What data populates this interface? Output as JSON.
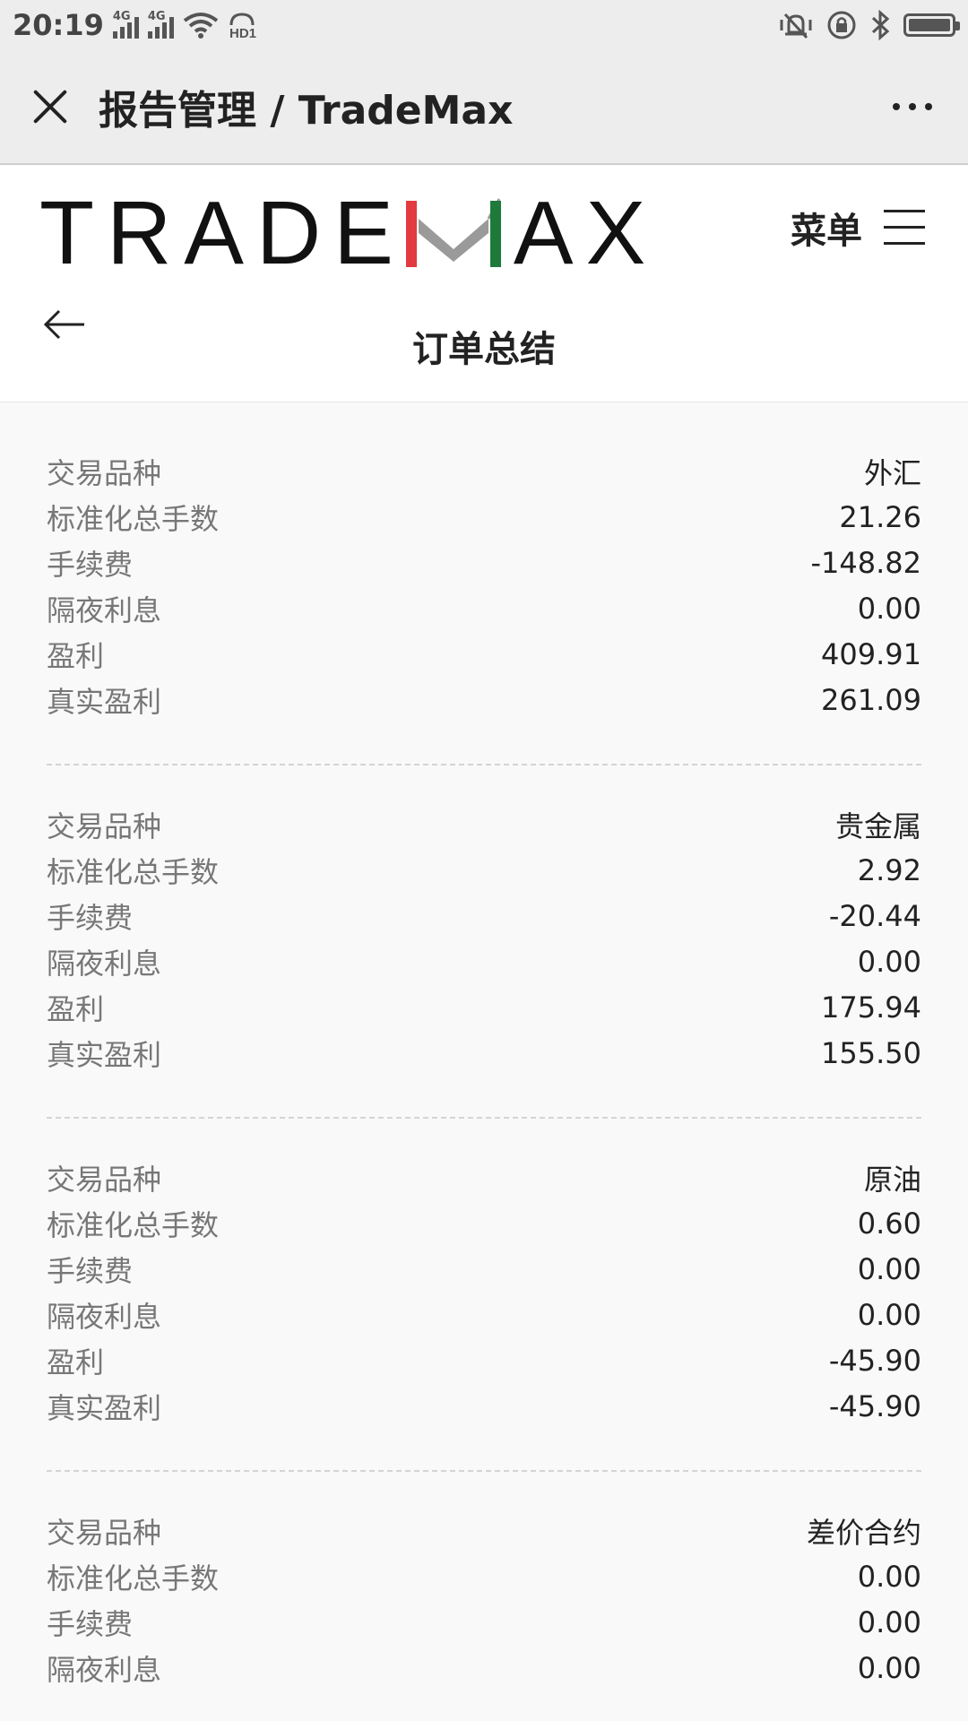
{
  "status_bar": {
    "time": "20:19",
    "network_1": "4G",
    "network_2": "4G",
    "hd_label": "HD1",
    "icons": [
      "signal-icon",
      "wifi-icon",
      "hd-icon",
      "vibrate-icon",
      "rotation-lock-icon",
      "bluetooth-icon",
      "battery-icon"
    ],
    "battery_level": 1.0
  },
  "title_bar": {
    "title": "报告管理 / TradeMax"
  },
  "header": {
    "logo_left": "TRADE",
    "logo_right": "AX",
    "menu_label": "菜单",
    "page_title": "订单总结",
    "colors": {
      "logo_red": "#e23a3f",
      "logo_green": "#1e7a3a",
      "logo_gray": "#9a9a9a"
    }
  },
  "summary": [
    {
      "rows": [
        {
          "label": "交易品种",
          "value": "外汇"
        },
        {
          "label": "标准化总手数",
          "value": "21.26"
        },
        {
          "label": "手续费",
          "value": "-148.82"
        },
        {
          "label": "隔夜利息",
          "value": "0.00"
        },
        {
          "label": "盈利",
          "value": "409.91"
        },
        {
          "label": "真实盈利",
          "value": "261.09"
        }
      ]
    },
    {
      "rows": [
        {
          "label": "交易品种",
          "value": "贵金属"
        },
        {
          "label": "标准化总手数",
          "value": "2.92"
        },
        {
          "label": "手续费",
          "value": "-20.44"
        },
        {
          "label": "隔夜利息",
          "value": "0.00"
        },
        {
          "label": "盈利",
          "value": "175.94"
        },
        {
          "label": "真实盈利",
          "value": "155.50"
        }
      ]
    },
    {
      "rows": [
        {
          "label": "交易品种",
          "value": "原油"
        },
        {
          "label": "标准化总手数",
          "value": "0.60"
        },
        {
          "label": "手续费",
          "value": "0.00"
        },
        {
          "label": "隔夜利息",
          "value": "0.00"
        },
        {
          "label": "盈利",
          "value": "-45.90"
        },
        {
          "label": "真实盈利",
          "value": "-45.90"
        }
      ]
    },
    {
      "rows": [
        {
          "label": "交易品种",
          "value": "差价合约"
        },
        {
          "label": "标准化总手数",
          "value": "0.00"
        },
        {
          "label": "手续费",
          "value": "0.00"
        },
        {
          "label": "隔夜利息",
          "value": "0.00"
        }
      ]
    }
  ]
}
